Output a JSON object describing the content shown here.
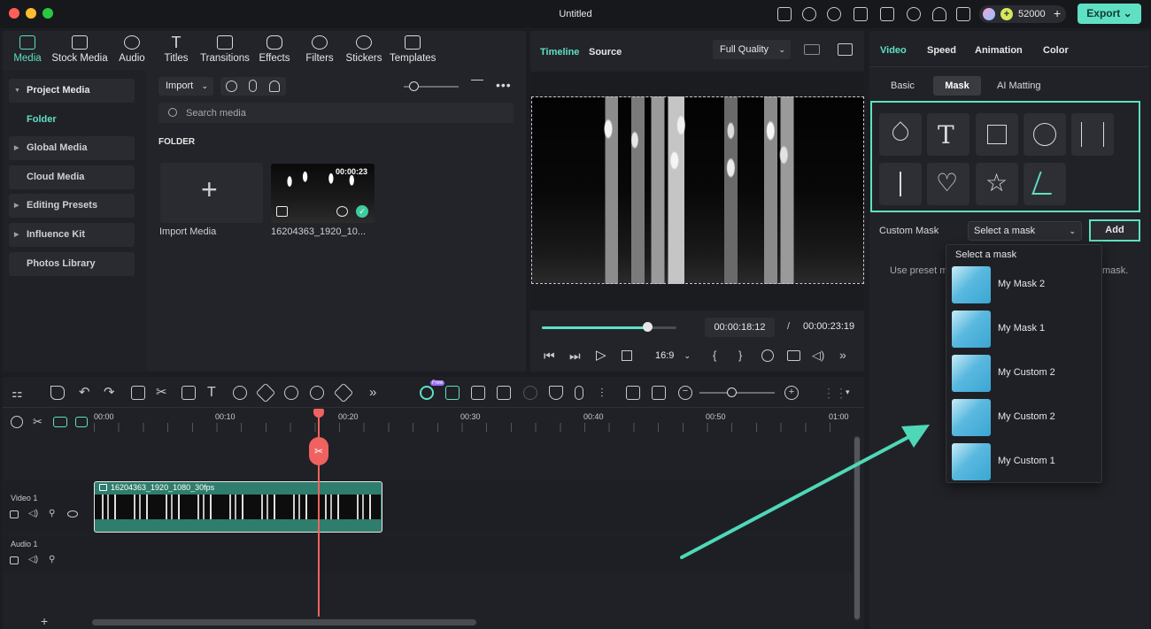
{
  "window": {
    "title": "Untitled",
    "credits": "52000",
    "export_label": "Export"
  },
  "media_tabs": [
    {
      "label": "Media",
      "active": true
    },
    {
      "label": "Stock Media"
    },
    {
      "label": "Audio"
    },
    {
      "label": "Titles"
    },
    {
      "label": "Transitions"
    },
    {
      "label": "Effects"
    },
    {
      "label": "Filters"
    },
    {
      "label": "Stickers"
    },
    {
      "label": "Templates"
    }
  ],
  "sidebar": {
    "items": [
      {
        "label": "Project Media"
      },
      {
        "label": "Folder"
      },
      {
        "label": "Global Media"
      },
      {
        "label": "Cloud Media"
      },
      {
        "label": "Editing Presets"
      },
      {
        "label": "Influence Kit"
      },
      {
        "label": "Photos Library"
      }
    ]
  },
  "media": {
    "import_label": "Import",
    "search_placeholder": "Search media",
    "folder_heading": "FOLDER",
    "import_media_label": "Import Media",
    "clip_name": "16204363_1920_10...",
    "clip_duration": "00:00:23"
  },
  "preview": {
    "tab_timeline": "Timeline",
    "tab_source": "Source",
    "quality": "Full Quality",
    "current_time": "00:00:18:12",
    "separator": "/",
    "total_time": "00:00:23:19",
    "aspect": "16:9",
    "playhead_progress": 0.78
  },
  "inspector": {
    "tabs": [
      "Video",
      "Speed",
      "Animation",
      "Color"
    ],
    "subtabs": [
      "Basic",
      "Mask",
      "AI Matting"
    ],
    "mask_icons": [
      "pen-mask-icon",
      "text-mask-icon",
      "rectangle-mask-icon",
      "circle-mask-icon",
      "double-line-mask-icon",
      "single-line-mask-icon",
      "heart-mask-icon",
      "star-mask-icon",
      "brush-mask-icon"
    ],
    "custom_mask_label": "Custom Mask",
    "select_placeholder": "Select a mask",
    "add_label": "Add",
    "hint_left": "Use preset m",
    "hint_right": "mask.",
    "dropdown": {
      "header": "Select a mask",
      "items": [
        "My Mask 2",
        "My Mask 1",
        "My Custom 2",
        "My Custom 2",
        "My Custom 1"
      ]
    }
  },
  "timeline": {
    "ruler": [
      "00:00",
      "00:10",
      "00:20",
      "00:30",
      "00:40",
      "00:50",
      "01:00"
    ],
    "tracks": [
      {
        "label": "Video 1"
      },
      {
        "label": "Audio 1"
      }
    ],
    "clip_label": "16204363_1920_1080_30fps",
    "free_badge": "Free"
  },
  "accent": "#5fe0c3"
}
